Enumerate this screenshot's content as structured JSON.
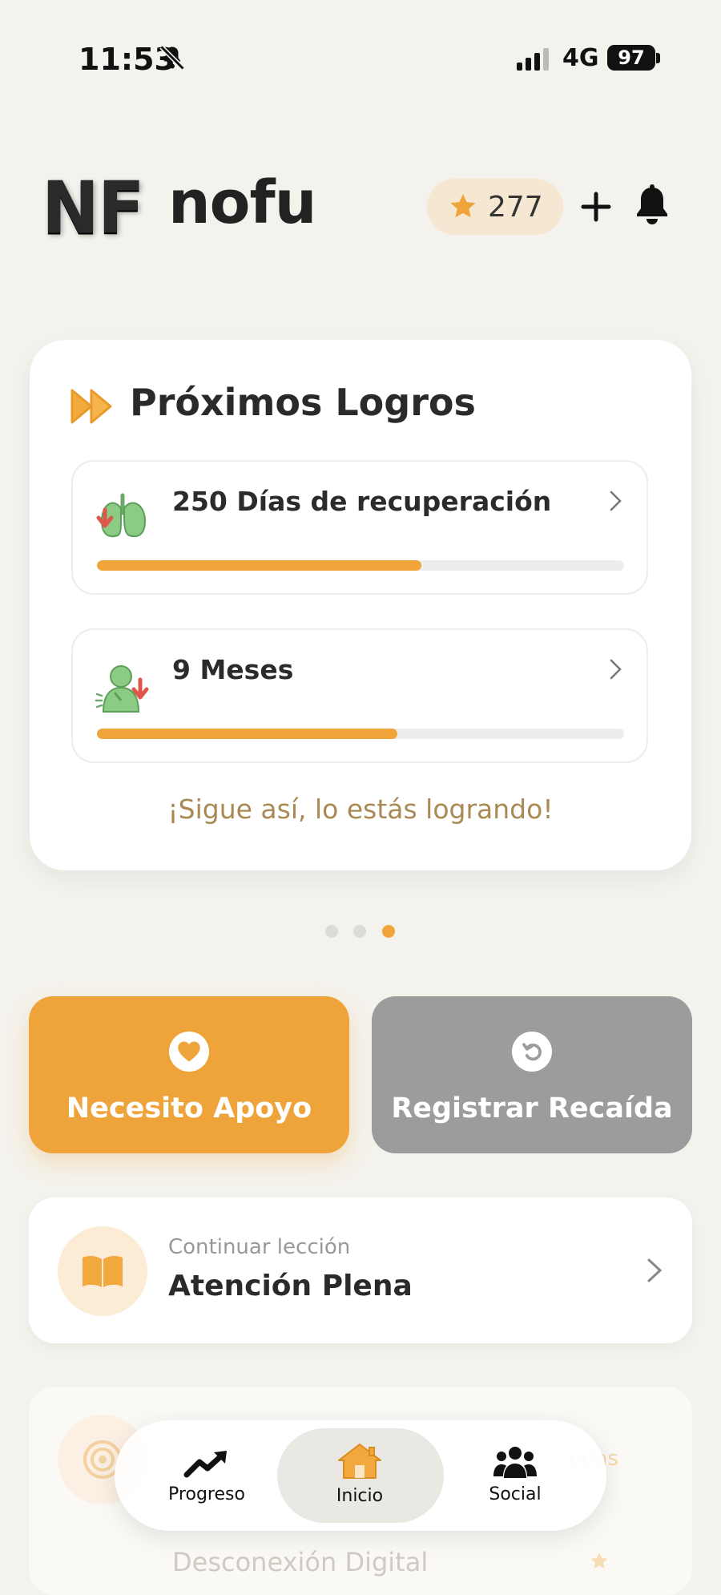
{
  "status_bar": {
    "time": "11:53",
    "network": "4G",
    "battery": "97"
  },
  "header": {
    "logo_mark": "NF",
    "app_name": "nofu",
    "points": "277"
  },
  "achievements": {
    "title": "Próximos Logros",
    "items": [
      {
        "label": "250 Días de recuperación",
        "icon": "lungs-icon",
        "progress": 0.615
      },
      {
        "label": "9 Meses",
        "icon": "person-down-icon",
        "progress": 0.57
      }
    ],
    "encouragement": "¡Sigue así, lo estás logrando!"
  },
  "carousel": {
    "pages": 3,
    "active": 3
  },
  "actions": {
    "support_label": "Necesito Apoyo",
    "relapse_label": "Registrar Recaída"
  },
  "lesson": {
    "subtitle": "Continuar lección",
    "title": "Atención Plena"
  },
  "faded_card": {
    "see_all": "todas",
    "subtitle": "Desconexión Digital"
  },
  "nav": {
    "items": [
      {
        "label": "Progreso",
        "icon": "trend-up-icon"
      },
      {
        "label": "Inicio",
        "icon": "home-icon"
      },
      {
        "label": "Social",
        "icon": "people-icon"
      }
    ],
    "active": "Inicio"
  },
  "colors": {
    "accent": "#EFA43B",
    "background": "#F4F2EC",
    "gray_button": "#9C9C9C",
    "encourage_text": "#A98954"
  }
}
